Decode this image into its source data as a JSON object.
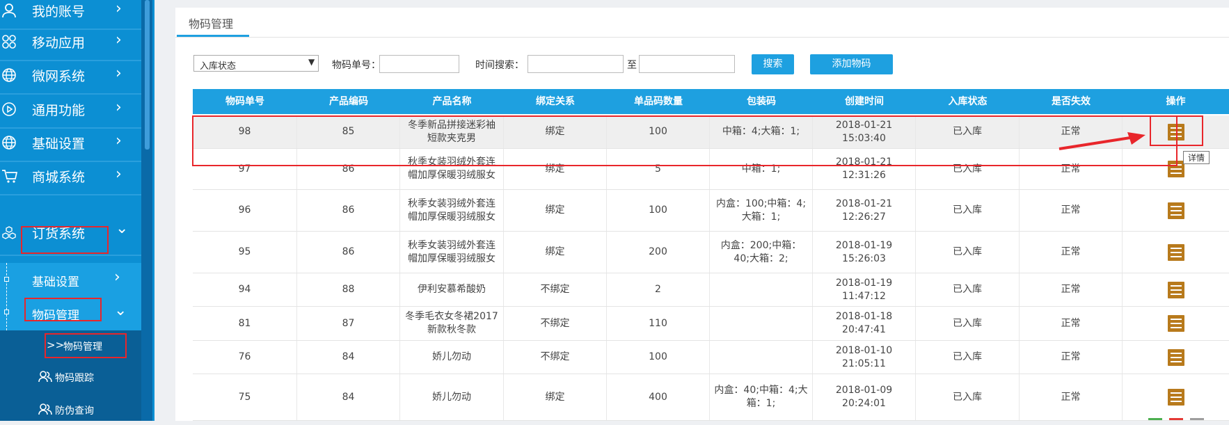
{
  "colors": {
    "sidebar": "#0c8fd3",
    "accent": "#1ea0e0",
    "highlight": "#e8262b",
    "op_icon": "#b87a1c"
  },
  "sidebar": {
    "items": [
      {
        "label": "我的账号",
        "icon": "user-icon",
        "arrow": "›"
      },
      {
        "label": "移动应用",
        "icon": "grid-icon",
        "arrow": "›"
      },
      {
        "label": "微网系统",
        "icon": "globe-icon",
        "arrow": "›"
      },
      {
        "label": "通用功能",
        "icon": "play-icon",
        "arrow": "›"
      },
      {
        "label": "基础设置",
        "icon": "globe-icon",
        "arrow": "›"
      },
      {
        "label": "商城系统",
        "icon": "cart-icon",
        "arrow": "›"
      },
      {
        "label": "订货系统",
        "icon": "cubes-icon",
        "arrow": "⌄"
      }
    ],
    "sub_items": [
      {
        "label": "基础设置",
        "arrow": "›"
      },
      {
        "label": "物码管理",
        "arrow": "⌄"
      }
    ],
    "leaf_items": [
      {
        "label": "物码管理",
        "icon": "double-chevron-icon"
      },
      {
        "label": "物码跟踪",
        "icon": "users-icon"
      },
      {
        "label": "防伪查询",
        "icon": "users-icon"
      }
    ]
  },
  "tab": {
    "label": "物码管理"
  },
  "filters": {
    "status_select": "入库状态",
    "status_arrow": "▼",
    "code_label": "物码单号：",
    "time_label": "时间搜索：",
    "to_label": "至",
    "search_button": "搜索",
    "add_button": "添加物码"
  },
  "table": {
    "headers": [
      "物码单号",
      "产品编码",
      "产品名称",
      "绑定关系",
      "单品码数量",
      "包装码",
      "创建时间",
      "入库状态",
      "是否失效",
      "操作"
    ],
    "rows": [
      {
        "id": "98",
        "product_code": "85",
        "name": "冬季新品拼接迷彩袖短款夹克男",
        "bind": "绑定",
        "qty": "100",
        "pack": "中箱：4;大箱：1;",
        "created": "2018-01-21 15:03:40",
        "status": "已入库",
        "valid": "正常"
      },
      {
        "id": "97",
        "product_code": "86",
        "name": "秋季女装羽绒外套连帽加厚保暖羽绒服女",
        "bind": "绑定",
        "qty": "5",
        "pack": "中箱：1;",
        "created": "2018-01-21 12:31:26",
        "status": "已入库",
        "valid": "正常"
      },
      {
        "id": "96",
        "product_code": "86",
        "name": "秋季女装羽绒外套连帽加厚保暖羽绒服女",
        "bind": "绑定",
        "qty": "100",
        "pack": "内盒：100;中箱：4;大箱：1;",
        "created": "2018-01-21 12:26:27",
        "status": "已入库",
        "valid": "正常"
      },
      {
        "id": "95",
        "product_code": "86",
        "name": "秋季女装羽绒外套连帽加厚保暖羽绒服女",
        "bind": "绑定",
        "qty": "200",
        "pack": "内盒：200;中箱：40;大箱：2;",
        "created": "2018-01-19 15:26:03",
        "status": "已入库",
        "valid": "正常"
      },
      {
        "id": "94",
        "product_code": "88",
        "name": "伊利安慕希酸奶",
        "bind": "不绑定",
        "qty": "2",
        "pack": "",
        "created": "2018-01-19 11:47:12",
        "status": "已入库",
        "valid": "正常"
      },
      {
        "id": "81",
        "product_code": "87",
        "name": "冬季毛衣女冬裙2017新款秋冬款",
        "bind": "不绑定",
        "qty": "110",
        "pack": "",
        "created": "2018-01-18 20:47:41",
        "status": "已入库",
        "valid": "正常"
      },
      {
        "id": "76",
        "product_code": "84",
        "name": "娇儿勿动",
        "bind": "不绑定",
        "qty": "100",
        "pack": "",
        "created": "2018-01-10 21:05:11",
        "status": "已入库",
        "valid": "正常"
      },
      {
        "id": "75",
        "product_code": "84",
        "name": "娇儿勿动",
        "bind": "绑定",
        "qty": "400",
        "pack": "内盒：40;中箱：4;大箱：1;",
        "created": "2018-01-09 20:24:01",
        "status": "已入库",
        "valid": "正常"
      }
    ]
  },
  "tooltip": "详情"
}
